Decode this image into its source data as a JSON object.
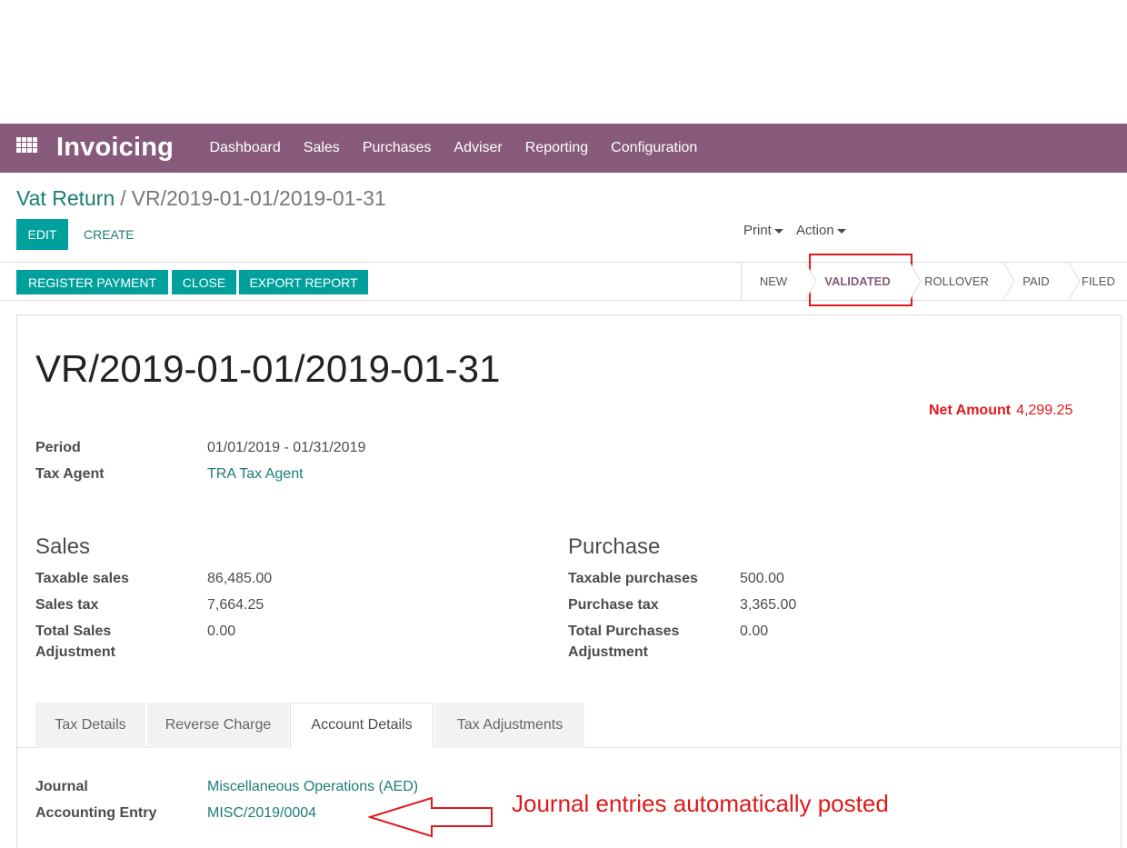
{
  "navbar": {
    "app_title": "Invoicing",
    "menu": [
      "Dashboard",
      "Sales",
      "Purchases",
      "Adviser",
      "Reporting",
      "Configuration"
    ],
    "bg_color": "#875a7b"
  },
  "breadcrumb": {
    "parent": "Vat Return",
    "separator": "/",
    "current": "VR/2019-01-01/2019-01-31"
  },
  "control_panel": {
    "edit_label": "EDIT",
    "create_label": "CREATE",
    "print_label": "Print",
    "action_label": "Action"
  },
  "statusbar": {
    "buttons": [
      "REGISTER PAYMENT",
      "CLOSE",
      "EXPORT REPORT"
    ],
    "stages": [
      "NEW",
      "VALIDATED",
      "ROLLOVER",
      "PAID",
      "FILED"
    ],
    "active_stage": "VALIDATED"
  },
  "record": {
    "title": "VR/2019-01-01/2019-01-31",
    "net_amount_label": "Net Amount",
    "net_amount_value": "4,299.25",
    "period_label": "Period",
    "period_value": "01/01/2019 - 01/31/2019",
    "tax_agent_label": "Tax Agent",
    "tax_agent_value": "TRA Tax Agent"
  },
  "sales": {
    "title": "Sales",
    "taxable_label": "Taxable sales",
    "taxable_value": "86,485.00",
    "tax_label": "Sales tax",
    "tax_value": "7,664.25",
    "adjustment_label_1": "Total Sales",
    "adjustment_label_2": "Adjustment",
    "adjustment_value": "0.00"
  },
  "purchase": {
    "title": "Purchase",
    "taxable_label": "Taxable purchases",
    "taxable_value": "500.00",
    "tax_label": "Purchase tax",
    "tax_value": "3,365.00",
    "adjustment_label_1": "Total Purchases",
    "adjustment_label_2": "Adjustment",
    "adjustment_value": "0.00"
  },
  "tabs": [
    "Tax Details",
    "Reverse Charge",
    "Account Details",
    "Tax Adjustments"
  ],
  "active_tab": "Account Details",
  "account_details": {
    "journal_label": "Journal",
    "journal_value": "Miscellaneous Operations (AED)",
    "entry_label": "Accounting Entry",
    "entry_value": "MISC/2019/0004"
  },
  "annotation": {
    "text": "Journal entries automatically posted",
    "color": "#e0191b"
  }
}
